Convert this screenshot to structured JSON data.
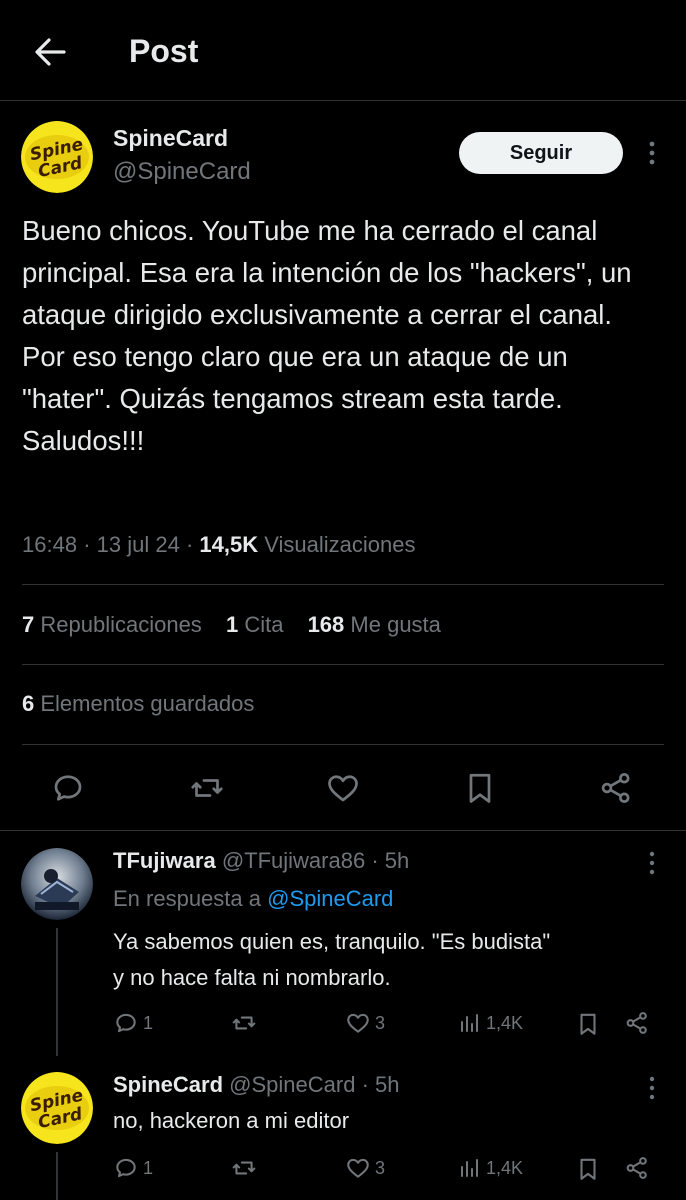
{
  "header": {
    "title": "Post"
  },
  "post": {
    "author_name": "SpineCard",
    "author_handle": "@SpineCard",
    "follow_label": "Seguir",
    "text": "Bueno chicos. YouTube me ha cerrado el canal principal. Esa era la intención de los \"hackers\", un ataque dirigido exclusivamente a cerrar el canal. Por eso tengo claro que era un ataque de un \"hater\". Quizás tengamos stream esta tarde. Saludos!!!",
    "time": "16:48",
    "date": "13 jul 24",
    "views_count": "14,5K",
    "views_label": "Visualizaciones",
    "reposts_count": "7",
    "reposts_label": "Republicaciones",
    "quotes_count": "1",
    "quotes_label": "Cita",
    "likes_count": "168",
    "likes_label": "Me gusta",
    "bookmarks_count": "6",
    "bookmarks_label": "Elementos guardados",
    "avatar_text_top": "Spine",
    "avatar_text_bottom": "Card"
  },
  "replies": [
    {
      "name": "TFujiwara",
      "handle": "@TFujiwara86",
      "time": "5h",
      "replying_prefix": "En respuesta a",
      "replying_to": "@SpineCard",
      "text_line1": "Ya sabemos quien es, tranquilo. \"Es budista\"",
      "text_line2": "y no hace falta ni nombrarlo.",
      "reply_count": "1",
      "like_count": "3",
      "view_count": "1,4K"
    },
    {
      "name": "SpineCard",
      "handle": "@SpineCard",
      "time": "5h",
      "text_line1": "no, hackeron a mi editor",
      "reply_count": "1",
      "like_count": "3",
      "view_count": "1,4K"
    }
  ],
  "colors": {
    "background": "#000000",
    "text": "#e7e9ea",
    "muted": "#71767b",
    "divider": "#2f3336",
    "link": "#1d9bf0",
    "avatar_yellow": "#f6e51c"
  },
  "icons": {
    "back": "arrow-left-icon",
    "more": "more-vertical-icon",
    "reply": "reply-bubble-icon",
    "repost": "repost-icon",
    "like": "heart-icon",
    "bookmark": "bookmark-icon",
    "share": "share-icon",
    "views": "bar-chart-icon"
  }
}
